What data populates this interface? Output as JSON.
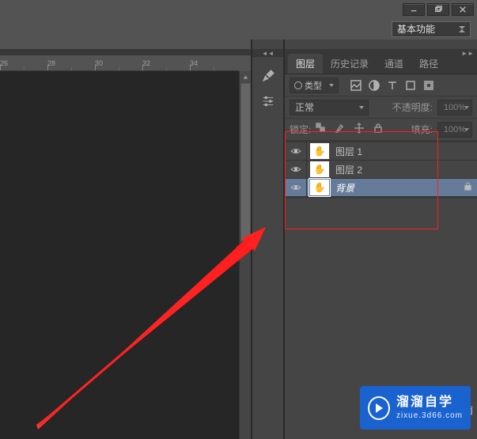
{
  "window": {
    "minimize": "−",
    "maximize": "❐",
    "close": "✕"
  },
  "workspace": {
    "label": "基本功能"
  },
  "ruler": {
    "ticks": [
      "26",
      "28",
      "30",
      "32",
      "34"
    ]
  },
  "panel": {
    "tabs": [
      {
        "label": "图层",
        "active": true
      },
      {
        "label": "历史记录",
        "active": false
      },
      {
        "label": "通道",
        "active": false
      },
      {
        "label": "路径",
        "active": false
      }
    ],
    "filter_type": "类型",
    "blend_mode": "正常",
    "opacity_label": "不透明度:",
    "opacity_value": "100%",
    "lock_label": "锁定:",
    "fill_label": "填充:",
    "fill_value": "100%",
    "layers": [
      {
        "name": "图层 1",
        "locked": false,
        "selected": false
      },
      {
        "name": "图层 2",
        "locked": false,
        "selected": false
      },
      {
        "name": "背景",
        "locked": true,
        "selected": true
      }
    ]
  },
  "watermark": {
    "title": "溜溜自学",
    "sub": "zixue.3d66.com"
  },
  "side_text": "南"
}
